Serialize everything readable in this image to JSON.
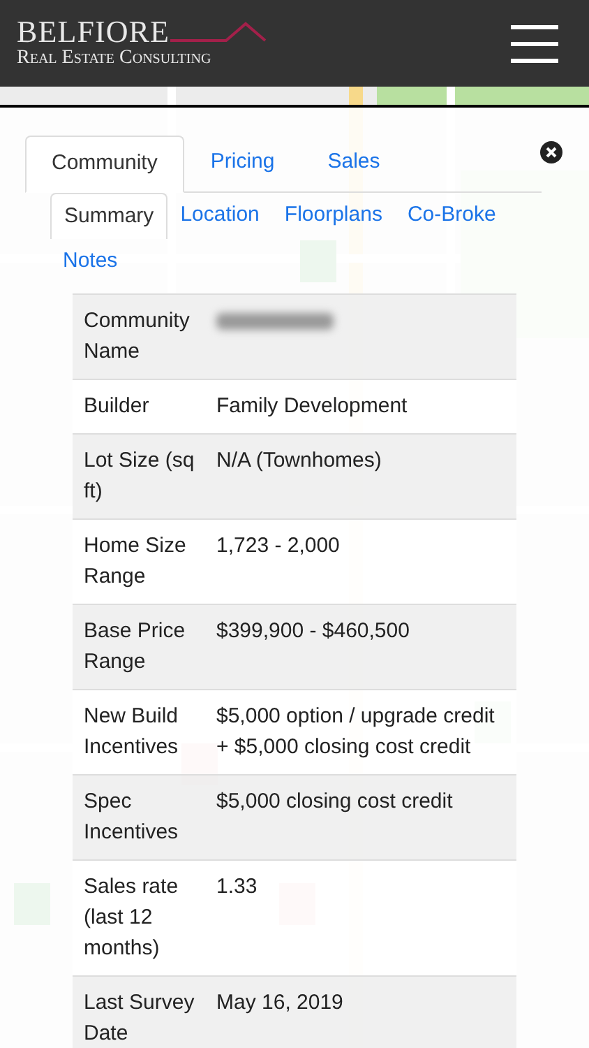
{
  "header": {
    "logo_title": "BELFIORE",
    "logo_subtitle": "Real Estate Consulting"
  },
  "tabs": [
    {
      "label": "Community",
      "selected": true
    },
    {
      "label": "Pricing",
      "selected": false
    },
    {
      "label": "Sales",
      "selected": false
    }
  ],
  "subtabs": [
    {
      "label": "Summary",
      "selected": true
    },
    {
      "label": "Location",
      "selected": false
    },
    {
      "label": "Floorplans",
      "selected": false
    },
    {
      "label": "Co-Broke",
      "selected": false
    },
    {
      "label": "Notes",
      "selected": false
    }
  ],
  "rows": [
    {
      "label": "Community Name",
      "value": "",
      "blurred": true
    },
    {
      "label": "Builder",
      "value": "Family Development",
      "blurred": false
    },
    {
      "label": "Lot Size (sq ft)",
      "value": "N/A (Townhomes)",
      "blurred": false
    },
    {
      "label": "Home Size Range",
      "value": "1,723 - 2,000",
      "blurred": false
    },
    {
      "label": "Base Price Range",
      "value": "$399,900 - $460,500",
      "blurred": false
    },
    {
      "label": "New Build Incentives",
      "value": "$5,000 option / upgrade credit + $5,000 closing cost credit",
      "blurred": false
    },
    {
      "label": "Spec Incentives",
      "value": "$5,000 closing cost credit",
      "blurred": false
    },
    {
      "label": "Sales rate (last 12 months)",
      "value": "1.33",
      "blurred": false
    },
    {
      "label": "Last Survey Date",
      "value": "May 16, 2019",
      "blurred": false
    }
  ]
}
